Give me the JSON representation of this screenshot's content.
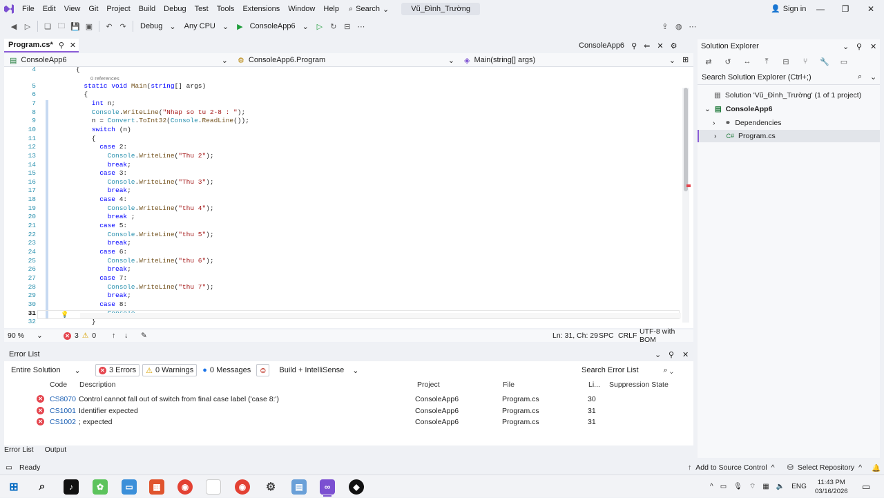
{
  "menubar": {
    "items": [
      "File",
      "Edit",
      "View",
      "Git",
      "Project",
      "Build",
      "Debug",
      "Test",
      "Tools",
      "Extensions",
      "Window",
      "Help"
    ],
    "search_label": "Search",
    "solution_name": "Vũ_Đình_Trường",
    "signin_label": "Sign in"
  },
  "toolbar": {
    "config": "Debug",
    "platform": "Any CPU",
    "run_target": "ConsoleApp6"
  },
  "editor": {
    "tab_label": "Program.cs*",
    "project_tab": "ConsoleApp6",
    "nav_project": "ConsoleApp6",
    "nav_class": "ConsoleApp6.Program",
    "nav_member": "Main(string[] args)",
    "references": "0 references",
    "lines": [
      {
        "n": "4",
        "t": "{"
      },
      {
        "n": "5",
        "t": "static void Main(string[] args)"
      },
      {
        "n": "6",
        "t": "{"
      },
      {
        "n": "7",
        "t": "int n;"
      },
      {
        "n": "8",
        "t": "Console.WriteLine(\"Nhap so tu 2-8 : \");"
      },
      {
        "n": "9",
        "t": "n = Convert.ToInt32(Console.ReadLine());"
      },
      {
        "n": "10",
        "t": "switch (n)"
      },
      {
        "n": "11",
        "t": "{"
      },
      {
        "n": "12",
        "t": "case 2:"
      },
      {
        "n": "13",
        "t": "Console.WriteLine(\"Thu 2\");"
      },
      {
        "n": "14",
        "t": "break;"
      },
      {
        "n": "15",
        "t": "case 3:"
      },
      {
        "n": "16",
        "t": "Console.WriteLine(\"Thu 3\");"
      },
      {
        "n": "17",
        "t": "break;"
      },
      {
        "n": "18",
        "t": "case 4:"
      },
      {
        "n": "19",
        "t": "Console.WriteLine(\"thu 4\");"
      },
      {
        "n": "20",
        "t": "break ;"
      },
      {
        "n": "21",
        "t": "case 5:"
      },
      {
        "n": "22",
        "t": "Console.WriteLine(\"thu 5\");"
      },
      {
        "n": "23",
        "t": "break;"
      },
      {
        "n": "24",
        "t": "case 6:"
      },
      {
        "n": "25",
        "t": "Console.WriteLine(\"thu 6\");"
      },
      {
        "n": "26",
        "t": "break;"
      },
      {
        "n": "27",
        "t": "case 7:"
      },
      {
        "n": "28",
        "t": "Console.WriteLine(\"thu 7\");"
      },
      {
        "n": "29",
        "t": "break;"
      },
      {
        "n": "30",
        "t": "case 8:"
      },
      {
        "n": "31",
        "t": "Console."
      },
      {
        "n": "32",
        "t": "}"
      }
    ],
    "zoom": "90 %",
    "error_count": "3",
    "warning_count": "0",
    "position": "Ln: 31, Ch: 29",
    "indent": "SPC",
    "line_ending": "CRLF",
    "encoding": "UTF-8 with BOM"
  },
  "solution_explorer": {
    "title": "Solution Explorer",
    "search_placeholder": "Search Solution Explorer (Ctrl+;)",
    "solution": "Solution 'Vũ_Đình_Trường' (1 of 1 project)",
    "project": "ConsoleApp6",
    "dependencies": "Dependencies",
    "file": "Program.cs"
  },
  "error_list": {
    "title": "Error List",
    "scope": "Entire Solution",
    "errors_filter": "3 Errors",
    "warnings_filter": "0 Warnings",
    "messages_filter": "0 Messages",
    "source": "Build + IntelliSense",
    "search_placeholder": "Search Error List",
    "columns": {
      "code": "Code",
      "description": "Description",
      "project": "Project",
      "file": "File",
      "line": "Li...",
      "suppression": "Suppression State"
    },
    "rows": [
      {
        "code": "CS8070",
        "description": "Control cannot fall out of switch from final case label ('case 8:')",
        "project": "ConsoleApp6",
        "file": "Program.cs",
        "line": "30"
      },
      {
        "code": "CS1001",
        "description": "Identifier expected",
        "project": "ConsoleApp6",
        "file": "Program.cs",
        "line": "31"
      },
      {
        "code": "CS1002",
        "description": "; expected",
        "project": "ConsoleApp6",
        "file": "Program.cs",
        "line": "31"
      }
    ]
  },
  "bottom_tabs": [
    "Error List",
    "Output"
  ],
  "status": {
    "ready": "Ready",
    "source_control": "Add to Source Control",
    "repository": "Select Repository"
  },
  "taskbar": {
    "lang": "ENG",
    "time": "11:43 PM",
    "date": "03/16/2026"
  },
  "colors": {
    "accent": "#8a5cd6",
    "error": "#e5454e",
    "keyword": "#0000ff",
    "type": "#2b91af",
    "string": "#a31515"
  }
}
